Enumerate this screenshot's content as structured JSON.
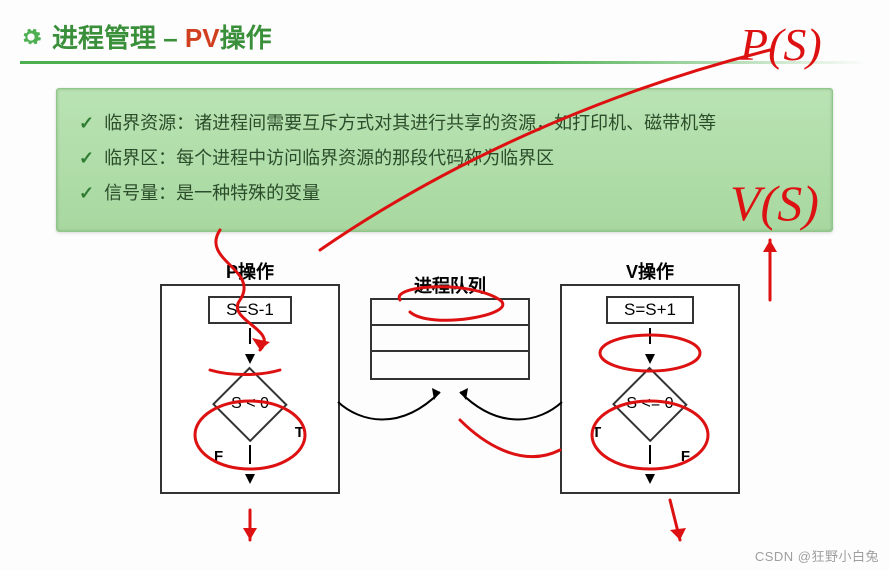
{
  "title": {
    "part1": "进程管理 – ",
    "part2": "PV",
    "part3": "操作"
  },
  "bullets": [
    "临界资源：诸进程间需要互斥方式对其进行共享的资源，如打印机、磁带机等",
    "临界区：每个进程中访问临界资源的那段代码称为临界区",
    "信号量：是一种特殊的变量"
  ],
  "diagram": {
    "p_title": "P操作",
    "v_title": "V操作",
    "queue_title": "进程队列",
    "p_step": "S=S-1",
    "v_step": "S=S+1",
    "p_cond": "S < 0",
    "v_cond": "S <= 0",
    "label_T": "T",
    "label_F": "F"
  },
  "annotations": {
    "top_right": "P(S)",
    "mid_right": "V(S)"
  },
  "watermark": "CSDN @狂野小白兔",
  "chart_data": {
    "type": "diagram",
    "title": "进程管理 – PV操作",
    "nodes": [
      {
        "id": "p_dec",
        "block": "P",
        "kind": "process",
        "text": "S=S-1"
      },
      {
        "id": "p_test",
        "block": "P",
        "kind": "decision",
        "text": "S < 0",
        "true_target": "queue",
        "false_target": "p_exit"
      },
      {
        "id": "p_exit",
        "block": "P",
        "kind": "terminator"
      },
      {
        "id": "queue",
        "block": "Q",
        "kind": "queue",
        "text": "进程队列"
      },
      {
        "id": "v_inc",
        "block": "V",
        "kind": "process",
        "text": "S=S+1"
      },
      {
        "id": "v_test",
        "block": "V",
        "kind": "decision",
        "text": "S <= 0",
        "true_target": "queue",
        "false_target": "v_exit"
      },
      {
        "id": "v_exit",
        "block": "V",
        "kind": "terminator"
      }
    ],
    "edges": [
      {
        "from": "p_dec",
        "to": "p_test"
      },
      {
        "from": "p_test",
        "to": "queue",
        "label": "T"
      },
      {
        "from": "p_test",
        "to": "p_exit",
        "label": "F"
      },
      {
        "from": "v_inc",
        "to": "v_test"
      },
      {
        "from": "v_test",
        "to": "queue",
        "label": "T"
      },
      {
        "from": "v_test",
        "to": "v_exit",
        "label": "F"
      }
    ],
    "handwritten_annotations": [
      "P(S)",
      "V(S)"
    ]
  }
}
